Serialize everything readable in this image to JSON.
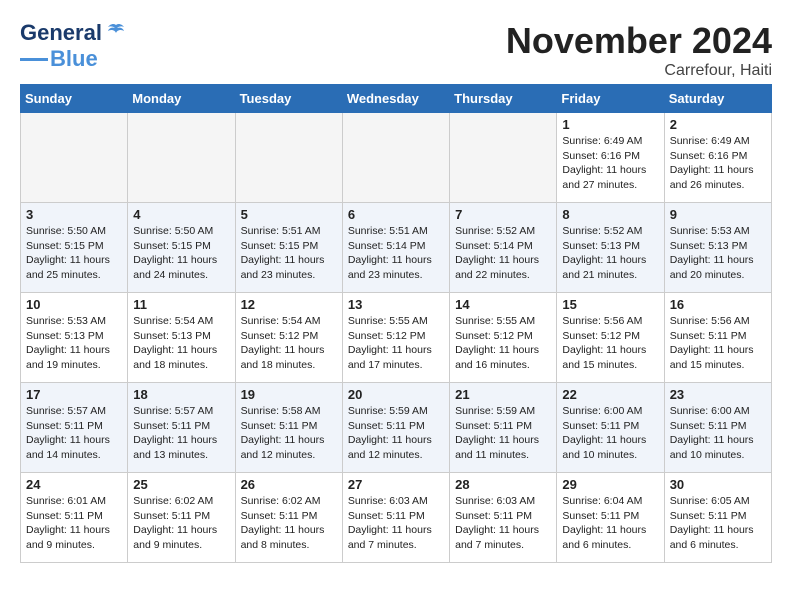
{
  "logo": {
    "line1": "General",
    "line2": "Blue"
  },
  "title": "November 2024",
  "location": "Carrefour, Haiti",
  "days_of_week": [
    "Sunday",
    "Monday",
    "Tuesday",
    "Wednesday",
    "Thursday",
    "Friday",
    "Saturday"
  ],
  "weeks": [
    [
      {
        "day": "",
        "info": "",
        "empty": true
      },
      {
        "day": "",
        "info": "",
        "empty": true
      },
      {
        "day": "",
        "info": "",
        "empty": true
      },
      {
        "day": "",
        "info": "",
        "empty": true
      },
      {
        "day": "",
        "info": "",
        "empty": true
      },
      {
        "day": "1",
        "info": "Sunrise: 6:49 AM\nSunset: 6:16 PM\nDaylight: 11 hours\nand 27 minutes."
      },
      {
        "day": "2",
        "info": "Sunrise: 6:49 AM\nSunset: 6:16 PM\nDaylight: 11 hours\nand 26 minutes."
      }
    ],
    [
      {
        "day": "3",
        "info": "Sunrise: 5:50 AM\nSunset: 5:15 PM\nDaylight: 11 hours\nand 25 minutes."
      },
      {
        "day": "4",
        "info": "Sunrise: 5:50 AM\nSunset: 5:15 PM\nDaylight: 11 hours\nand 24 minutes."
      },
      {
        "day": "5",
        "info": "Sunrise: 5:51 AM\nSunset: 5:15 PM\nDaylight: 11 hours\nand 23 minutes."
      },
      {
        "day": "6",
        "info": "Sunrise: 5:51 AM\nSunset: 5:14 PM\nDaylight: 11 hours\nand 23 minutes."
      },
      {
        "day": "7",
        "info": "Sunrise: 5:52 AM\nSunset: 5:14 PM\nDaylight: 11 hours\nand 22 minutes."
      },
      {
        "day": "8",
        "info": "Sunrise: 5:52 AM\nSunset: 5:13 PM\nDaylight: 11 hours\nand 21 minutes."
      },
      {
        "day": "9",
        "info": "Sunrise: 5:53 AM\nSunset: 5:13 PM\nDaylight: 11 hours\nand 20 minutes."
      }
    ],
    [
      {
        "day": "10",
        "info": "Sunrise: 5:53 AM\nSunset: 5:13 PM\nDaylight: 11 hours\nand 19 minutes."
      },
      {
        "day": "11",
        "info": "Sunrise: 5:54 AM\nSunset: 5:13 PM\nDaylight: 11 hours\nand 18 minutes."
      },
      {
        "day": "12",
        "info": "Sunrise: 5:54 AM\nSunset: 5:12 PM\nDaylight: 11 hours\nand 18 minutes."
      },
      {
        "day": "13",
        "info": "Sunrise: 5:55 AM\nSunset: 5:12 PM\nDaylight: 11 hours\nand 17 minutes."
      },
      {
        "day": "14",
        "info": "Sunrise: 5:55 AM\nSunset: 5:12 PM\nDaylight: 11 hours\nand 16 minutes."
      },
      {
        "day": "15",
        "info": "Sunrise: 5:56 AM\nSunset: 5:12 PM\nDaylight: 11 hours\nand 15 minutes."
      },
      {
        "day": "16",
        "info": "Sunrise: 5:56 AM\nSunset: 5:11 PM\nDaylight: 11 hours\nand 15 minutes."
      }
    ],
    [
      {
        "day": "17",
        "info": "Sunrise: 5:57 AM\nSunset: 5:11 PM\nDaylight: 11 hours\nand 14 minutes."
      },
      {
        "day": "18",
        "info": "Sunrise: 5:57 AM\nSunset: 5:11 PM\nDaylight: 11 hours\nand 13 minutes."
      },
      {
        "day": "19",
        "info": "Sunrise: 5:58 AM\nSunset: 5:11 PM\nDaylight: 11 hours\nand 12 minutes."
      },
      {
        "day": "20",
        "info": "Sunrise: 5:59 AM\nSunset: 5:11 PM\nDaylight: 11 hours\nand 12 minutes."
      },
      {
        "day": "21",
        "info": "Sunrise: 5:59 AM\nSunset: 5:11 PM\nDaylight: 11 hours\nand 11 minutes."
      },
      {
        "day": "22",
        "info": "Sunrise: 6:00 AM\nSunset: 5:11 PM\nDaylight: 11 hours\nand 10 minutes."
      },
      {
        "day": "23",
        "info": "Sunrise: 6:00 AM\nSunset: 5:11 PM\nDaylight: 11 hours\nand 10 minutes."
      }
    ],
    [
      {
        "day": "24",
        "info": "Sunrise: 6:01 AM\nSunset: 5:11 PM\nDaylight: 11 hours\nand 9 minutes."
      },
      {
        "day": "25",
        "info": "Sunrise: 6:02 AM\nSunset: 5:11 PM\nDaylight: 11 hours\nand 9 minutes."
      },
      {
        "day": "26",
        "info": "Sunrise: 6:02 AM\nSunset: 5:11 PM\nDaylight: 11 hours\nand 8 minutes."
      },
      {
        "day": "27",
        "info": "Sunrise: 6:03 AM\nSunset: 5:11 PM\nDaylight: 11 hours\nand 7 minutes."
      },
      {
        "day": "28",
        "info": "Sunrise: 6:03 AM\nSunset: 5:11 PM\nDaylight: 11 hours\nand 7 minutes."
      },
      {
        "day": "29",
        "info": "Sunrise: 6:04 AM\nSunset: 5:11 PM\nDaylight: 11 hours\nand 6 minutes."
      },
      {
        "day": "30",
        "info": "Sunrise: 6:05 AM\nSunset: 5:11 PM\nDaylight: 11 hours\nand 6 minutes."
      }
    ]
  ]
}
